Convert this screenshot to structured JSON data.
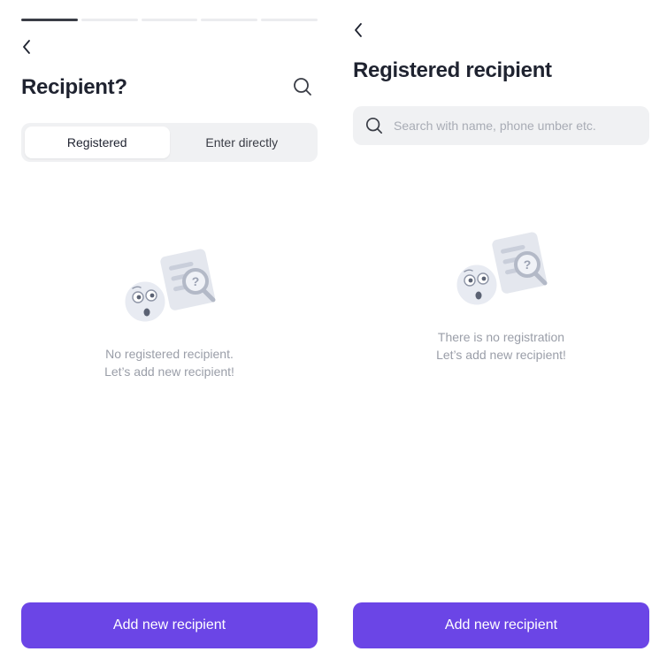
{
  "colors": {
    "primary": "#6B45E6",
    "progress_active": "#3A3D46",
    "progress_inactive": "#EBECEF",
    "field_bg": "#F0F1F3",
    "muted_text": "#9A9EA8"
  },
  "left_screen": {
    "progress": {
      "total_steps": 5,
      "current_step": 1
    },
    "back_icon": "chevron-left-icon",
    "title": "Recipient?",
    "search_icon": "search-icon",
    "tabs": [
      {
        "label": "Registered",
        "selected": true
      },
      {
        "label": "Enter directly",
        "selected": false
      }
    ],
    "empty_state": {
      "illustration": "confused-face-document-magnifier-illustration",
      "line1": "No registered recipient.",
      "line2": "Let’s add new recipient!"
    },
    "add_button_label": "Add new recipient"
  },
  "right_screen": {
    "back_icon": "chevron-left-icon",
    "title": "Registered recipient",
    "search": {
      "icon": "search-icon",
      "placeholder": "Search with name, phone umber etc.",
      "value": ""
    },
    "empty_state": {
      "illustration": "confused-face-document-magnifier-illustration",
      "line1": "There is no registration",
      "line2": "Let’s add new recipient!"
    },
    "add_button_label": "Add new recipient"
  }
}
